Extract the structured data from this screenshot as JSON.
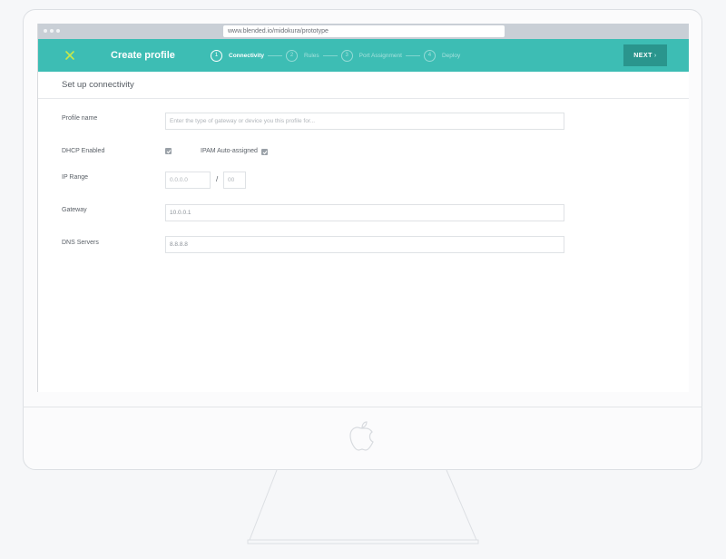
{
  "browser": {
    "url": "www.blended.io/midokura/prototype"
  },
  "header": {
    "title": "Create profile",
    "close_icon": "close-x-icon",
    "accent_color": "#3dbdb4",
    "next_label": "NEXT",
    "next_icon": "›"
  },
  "steps": [
    {
      "number": "1",
      "label": "Connectivity",
      "active": true
    },
    {
      "number": "2",
      "label": "Rules",
      "active": false
    },
    {
      "number": "3",
      "label": "Port Assignment",
      "active": false
    },
    {
      "number": "4",
      "label": "Deploy",
      "active": false
    }
  ],
  "section": {
    "title": "Set up connectivity"
  },
  "form": {
    "profile_name": {
      "label": "Profile name",
      "placeholder": "Enter the type of gateway or device you this profile for..."
    },
    "dhcp": {
      "label": "DHCP Enabled",
      "checked": true
    },
    "ipam": {
      "label": "IPAM Auto-assigned",
      "checked": true
    },
    "ip_range": {
      "label": "IP Range",
      "address_placeholder": "0.0.0.0",
      "separator": "/",
      "mask_placeholder": "00"
    },
    "gateway": {
      "label": "Gateway",
      "value": "10.0.0.1"
    },
    "dns": {
      "label": "DNS Servers",
      "value": "8.8.8.8"
    }
  }
}
